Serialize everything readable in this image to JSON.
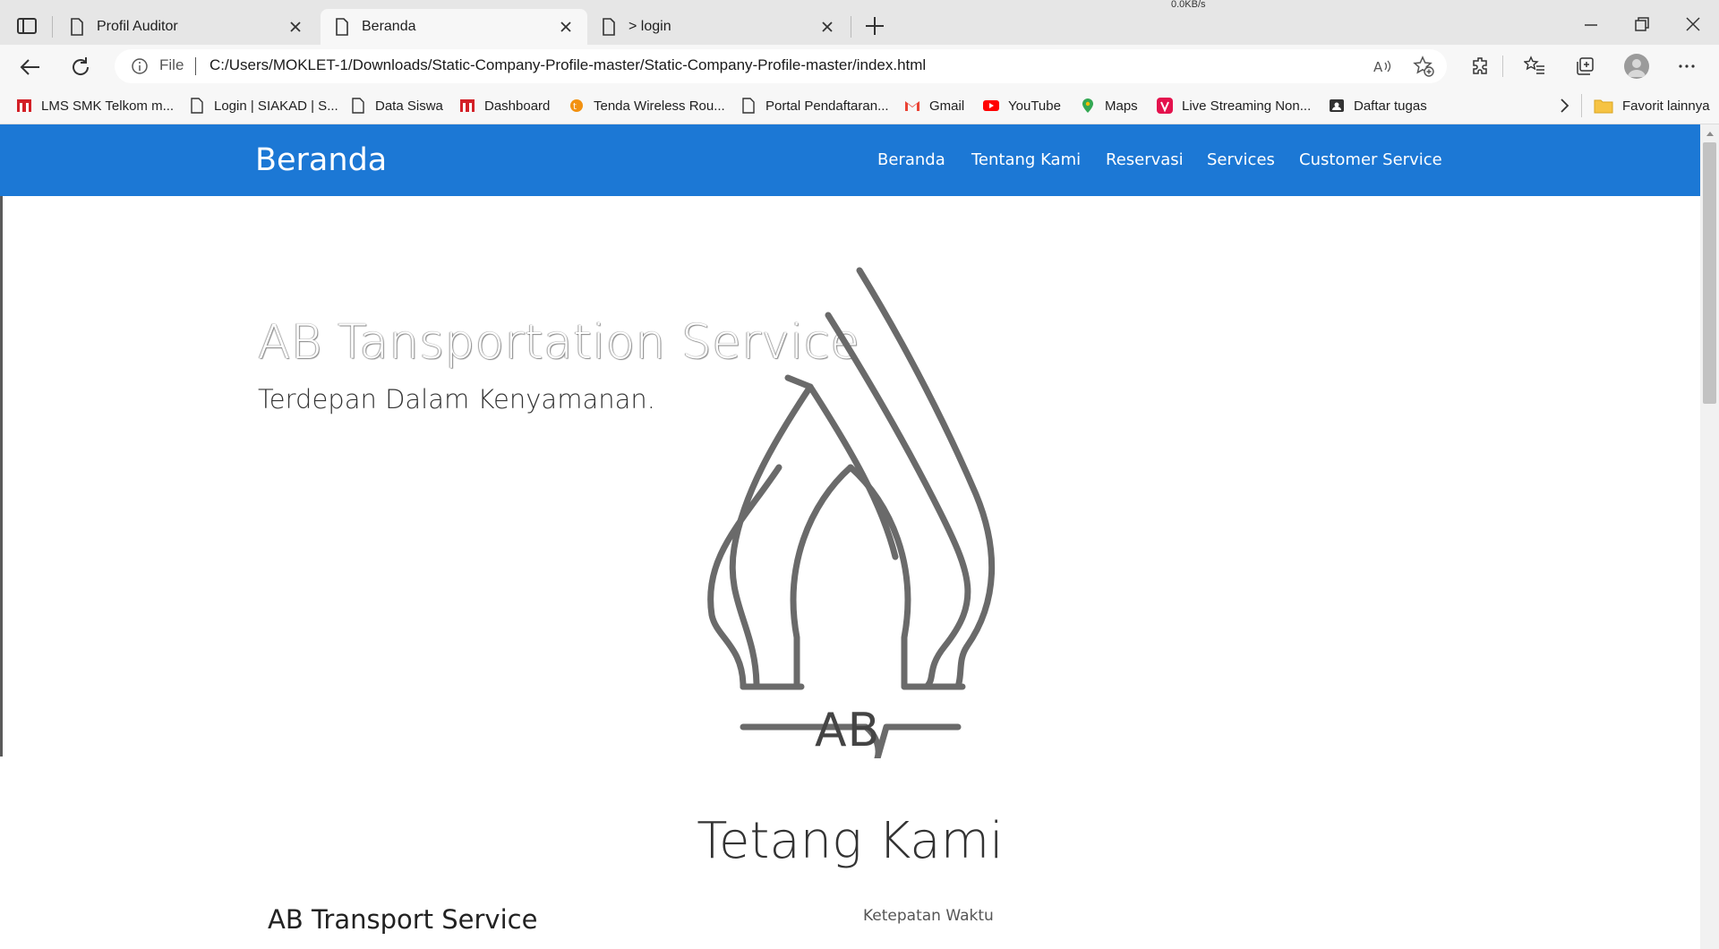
{
  "browser": {
    "tabs": [
      {
        "title": "Profil Auditor",
        "active": false
      },
      {
        "title": "Beranda",
        "active": true
      },
      {
        "title": "> login",
        "active": false
      }
    ],
    "tray_speed": "0.0KB/s",
    "address": {
      "scheme_label": "File",
      "url": "C:/Users/MOKLET-1/Downloads/Static-Company-Profile-master/Static-Company-Profile-master/index.html"
    },
    "bookmarks": [
      {
        "label": "LMS SMK Telkom m...",
        "icon": "telkom-icon"
      },
      {
        "label": "Login | SIAKAD | S...",
        "icon": "page-icon"
      },
      {
        "label": "Data Siswa",
        "icon": "page-icon"
      },
      {
        "label": "Dashboard",
        "icon": "telkom-icon"
      },
      {
        "label": "Tenda Wireless Rou...",
        "icon": "tenda-icon"
      },
      {
        "label": "Portal Pendaftaran...",
        "icon": "page-icon"
      },
      {
        "label": "Gmail",
        "icon": "gmail-icon"
      },
      {
        "label": "YouTube",
        "icon": "youtube-icon"
      },
      {
        "label": "Maps",
        "icon": "maps-icon"
      },
      {
        "label": "Live Streaming Non...",
        "icon": "vidio-icon"
      },
      {
        "label": "Daftar tugas",
        "icon": "tasks-icon"
      }
    ],
    "other_favorites": "Favorit lainnya"
  },
  "page": {
    "brand": "Beranda",
    "nav": [
      "Beranda",
      "Tentang Kami",
      "Reservasi",
      "Services",
      "Customer Service"
    ],
    "hero": {
      "title": "AB Tansportation Service",
      "subtitle": "Terdepan Dalam Kenyamanan.",
      "logo_text": "AB"
    },
    "about": {
      "heading": "Tetang Kami",
      "left_heading": "AB Transport Service",
      "right_text": "Ketepatan Waktu"
    }
  },
  "colors": {
    "navbar": "#1c78d5",
    "chrome": "#f7f7f7",
    "tabstrip": "#e6e6e6",
    "logo_stroke": "#6a6a6a"
  }
}
